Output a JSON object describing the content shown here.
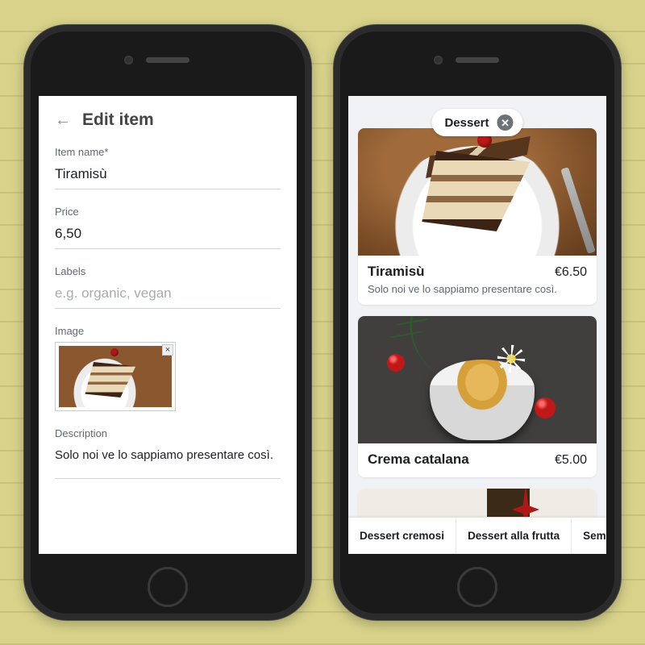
{
  "left": {
    "header": "Edit item",
    "fields": {
      "item_name": {
        "label": "Item name*",
        "value": "Tiramisù"
      },
      "price": {
        "label": "Price",
        "value": "6,50"
      },
      "labels": {
        "label": "Labels",
        "placeholder": "e.g. organic, vegan"
      },
      "image": {
        "label": "Image"
      },
      "description": {
        "label": "Description",
        "value": "Solo noi ve lo sappiamo presentare così."
      }
    }
  },
  "right": {
    "filter": {
      "label": "Dessert"
    },
    "items": [
      {
        "title": "Tiramisù",
        "price": "€6.50",
        "desc": "Solo noi ve lo sappiamo presentare così."
      },
      {
        "title": "Crema catalana",
        "price": "€5.00"
      }
    ],
    "tabs": [
      {
        "label": "Dessert cremosi"
      },
      {
        "label": "Dessert alla frutta"
      },
      {
        "label": "Semif"
      }
    ]
  }
}
